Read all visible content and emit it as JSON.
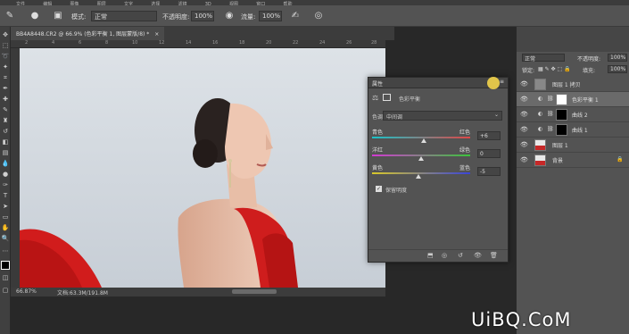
{
  "menu": {
    "items": [
      "文件",
      "编辑",
      "图像",
      "图层",
      "文字",
      "选择",
      "滤镜",
      "3D",
      "视图",
      "窗口",
      "帮助"
    ]
  },
  "options": {
    "mode_label": "模式:",
    "mode_value": "正常",
    "opacity_label": "不透明度:",
    "opacity_value": "100%",
    "flow_label": "流量:",
    "flow_value": "100%"
  },
  "document": {
    "tab_title": "BB4A8448.CR2 @ 66.9% (色彩平衡 1, 图层蒙版/8) *",
    "zoom": "66.87%",
    "doc_size": "文档:63.3M/191.8M",
    "ruler_ticks": [
      "2",
      "4",
      "6",
      "8",
      "10",
      "12",
      "14",
      "16",
      "18",
      "20",
      "22",
      "24",
      "26",
      "28"
    ]
  },
  "properties": {
    "title": "属性",
    "adjustment_name": "色彩平衡",
    "tone_label": "色调:",
    "tone_value": "中间调",
    "sliders": [
      {
        "left": "青色",
        "right": "红色",
        "value": "+6",
        "position": 0.53,
        "gradient": [
          "#19c3c9",
          "#e04646"
        ]
      },
      {
        "left": "洋红",
        "right": "绿色",
        "value": "0",
        "position": 0.5,
        "gradient": [
          "#d23ad2",
          "#3bc43b"
        ]
      },
      {
        "left": "黄色",
        "right": "蓝色",
        "value": "-5",
        "position": 0.47,
        "gradient": [
          "#d9c829",
          "#3a44d8"
        ]
      }
    ],
    "preserve_luminosity": "保留明度",
    "preserve_checked": true
  },
  "layers": {
    "blend_mode": "正常",
    "opacity_label": "不透明度:",
    "opacity_value": "100%",
    "lock_label": "锁定:",
    "fill_label": "填充:",
    "fill_value": "100%",
    "rows": [
      {
        "name": "图层 1 拷贝",
        "thumb": "#888888",
        "has_mask": false,
        "adj": false
      },
      {
        "name": "色彩平衡 1",
        "thumb": "#ffffff",
        "has_mask": true,
        "adj": true,
        "selected": true
      },
      {
        "name": "曲线 2",
        "thumb": "#000000",
        "has_mask": true,
        "adj": true
      },
      {
        "name": "曲线 1",
        "thumb": "#000000",
        "has_mask": true,
        "adj": true
      },
      {
        "name": "图层 1",
        "thumb": "#c62828",
        "has_mask": false,
        "adj": false
      },
      {
        "name": "背景",
        "thumb": "#c62828",
        "has_mask": false,
        "adj": false
      }
    ]
  },
  "watermark": "UiBQ.CoM"
}
